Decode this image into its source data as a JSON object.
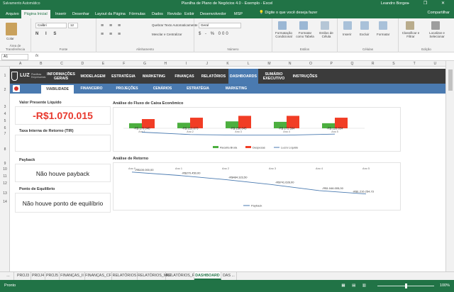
{
  "window": {
    "quick_access": "Salvamento Automático",
    "title": "Planilha de Plano de Negócios 4.0 - Exemplo - Excel",
    "user": "Leandro Borges",
    "controls": "–  ❐  ✕"
  },
  "ribbon_tabs": [
    "Arquivo",
    "Página Inicial",
    "Inserir",
    "Desenhar",
    "Layout da Página",
    "Fórmulas",
    "Dados",
    "Revisão",
    "Exibir",
    "Desenvolvedor",
    "MSP"
  ],
  "ribbon_tabs_active": 1,
  "tell_me": "Digite o que você deseja fazer",
  "share": "Compartilhar",
  "ribbon": {
    "paste": "Colar",
    "clipboard": "Área de Transferência",
    "font_name": "Calibri",
    "font_size": "12",
    "font": "Fonte",
    "wrap": "Quebrar Texto Automaticamente",
    "merge": "Mesclar e Centralizar",
    "alignment": "Alinhamento",
    "number_format": "Geral",
    "number": "Número",
    "cond_format": "Formatação Condicional",
    "table_format": "Formatar como Tabela",
    "cell_styles": "Estilos de Célula",
    "styles": "Estilos",
    "insert": "Inserir",
    "delete": "Excluir",
    "format": "Formatar",
    "cells": "Células",
    "sort": "Classificar e Filtrar",
    "find": "Localizar e Selecionar",
    "editing": "Edição"
  },
  "formula_bar": {
    "name_box": "A1",
    "fx": "fx"
  },
  "columns": [
    "A",
    "B",
    "C",
    "D",
    "E",
    "F",
    "G",
    "H",
    "I",
    "J",
    "K",
    "L",
    "M",
    "N",
    "O",
    "P",
    "Q",
    "R",
    "S",
    "T",
    "U"
  ],
  "rows": [
    "1",
    "2",
    "3",
    "4",
    "5",
    "6",
    "7",
    "8",
    "9",
    "10",
    "11",
    "12",
    "13",
    "14"
  ],
  "dashboard": {
    "logo": "LUZ",
    "logo_sub": "Planilhas Empresariais",
    "nav": [
      "INFORMAÇÕES GERAIS",
      "MODELAGEM",
      "ESTRATÉGIA",
      "MARKETING",
      "FINANÇAS",
      "RELATÓRIOS",
      "DASHBOARDS",
      "SUMÁRIO EXECUTIVO",
      "INSTRUÇÕES"
    ],
    "nav_active": 6,
    "subnav": [
      "VIABILIDADE",
      "FINANCEIRO",
      "PROJEÇÕES",
      "CENÁRIOS",
      "ESTRATÉGIA",
      "MARKETING"
    ],
    "subnav_active": 0
  },
  "kpis": {
    "npv_label": "Valor Presente Líquido",
    "npv_value": "-R$1.070.015",
    "irr_label": "Taxa Interna de Retorno (TIR)",
    "irr_value": "",
    "payback_label": "Payback",
    "payback_value": "Não houve payback",
    "breakeven_label": "Ponto de Equilíbrio",
    "breakeven_value": "Não houve ponto de equilíbrio"
  },
  "chart_data": [
    {
      "type": "bar",
      "title": "Análise do Fluxo de Caixa Econômico",
      "categories": [
        "Ano 1",
        "Ano 2",
        "Ano 3",
        "Ano 4",
        "Ano 5"
      ],
      "series": [
        {
          "name": "Receita Bruta",
          "color": "#4caf3f",
          "values": [
            0.55,
            0.6,
            0.75,
            0.7,
            0.55
          ]
        },
        {
          "name": "Despesas",
          "color": "#f13d25",
          "values": [
            1.0,
            1.15,
            1.35,
            1.35,
            1.15
          ]
        },
        {
          "name": "Lucro Líquido",
          "color": "#4a7ab0",
          "type": "line",
          "values": [
            -0.25,
            -0.8,
            -0.95,
            -0.95,
            -0.7
          ]
        }
      ],
      "data_labels": [
        "-R$ 170.040",
        "-R$ 213.873",
        "-R$ 258.845",
        "-R$ 272.594",
        "-R$ 126.834"
      ],
      "grid": false,
      "legend": "bottom"
    },
    {
      "type": "line",
      "title": "Análise de Retorno",
      "categories": [
        "Ano 0",
        "Ano 1",
        "Ano 2",
        "Ano 3",
        "Ano 4",
        "Ano 5"
      ],
      "series": [
        {
          "name": "Payback",
          "color": "#4a7ab0",
          "values": [
            -100000,
            -270450,
            -484323,
            -741628,
            -1046005,
            -1216254
          ]
        }
      ],
      "data_labels": [
        "-R$100.000,00",
        "-R$270.450,00",
        "-R$484.323,50",
        "-R$741.628,00",
        "-R$1.046.005,00",
        "-R$1.216.254,73"
      ],
      "ylim": [
        -1300000,
        0
      ],
      "grid": false,
      "legend": "bottom"
    }
  ],
  "sheet_tabs": [
    "...",
    "PROJ3",
    "PROJ4",
    "PROJ5",
    "FINANÇAS_II",
    "FINANÇAS_CF",
    "RELATÓRIOS",
    "RELATÓRIOS_MKT",
    "RELATÓRIOS_FIN",
    "DASHBOARD",
    "DAS ..."
  ],
  "sheet_tabs_active": 9,
  "status": {
    "ready": "Pronto",
    "zoom": "100%",
    "views": "▦ ▤ ▥"
  }
}
